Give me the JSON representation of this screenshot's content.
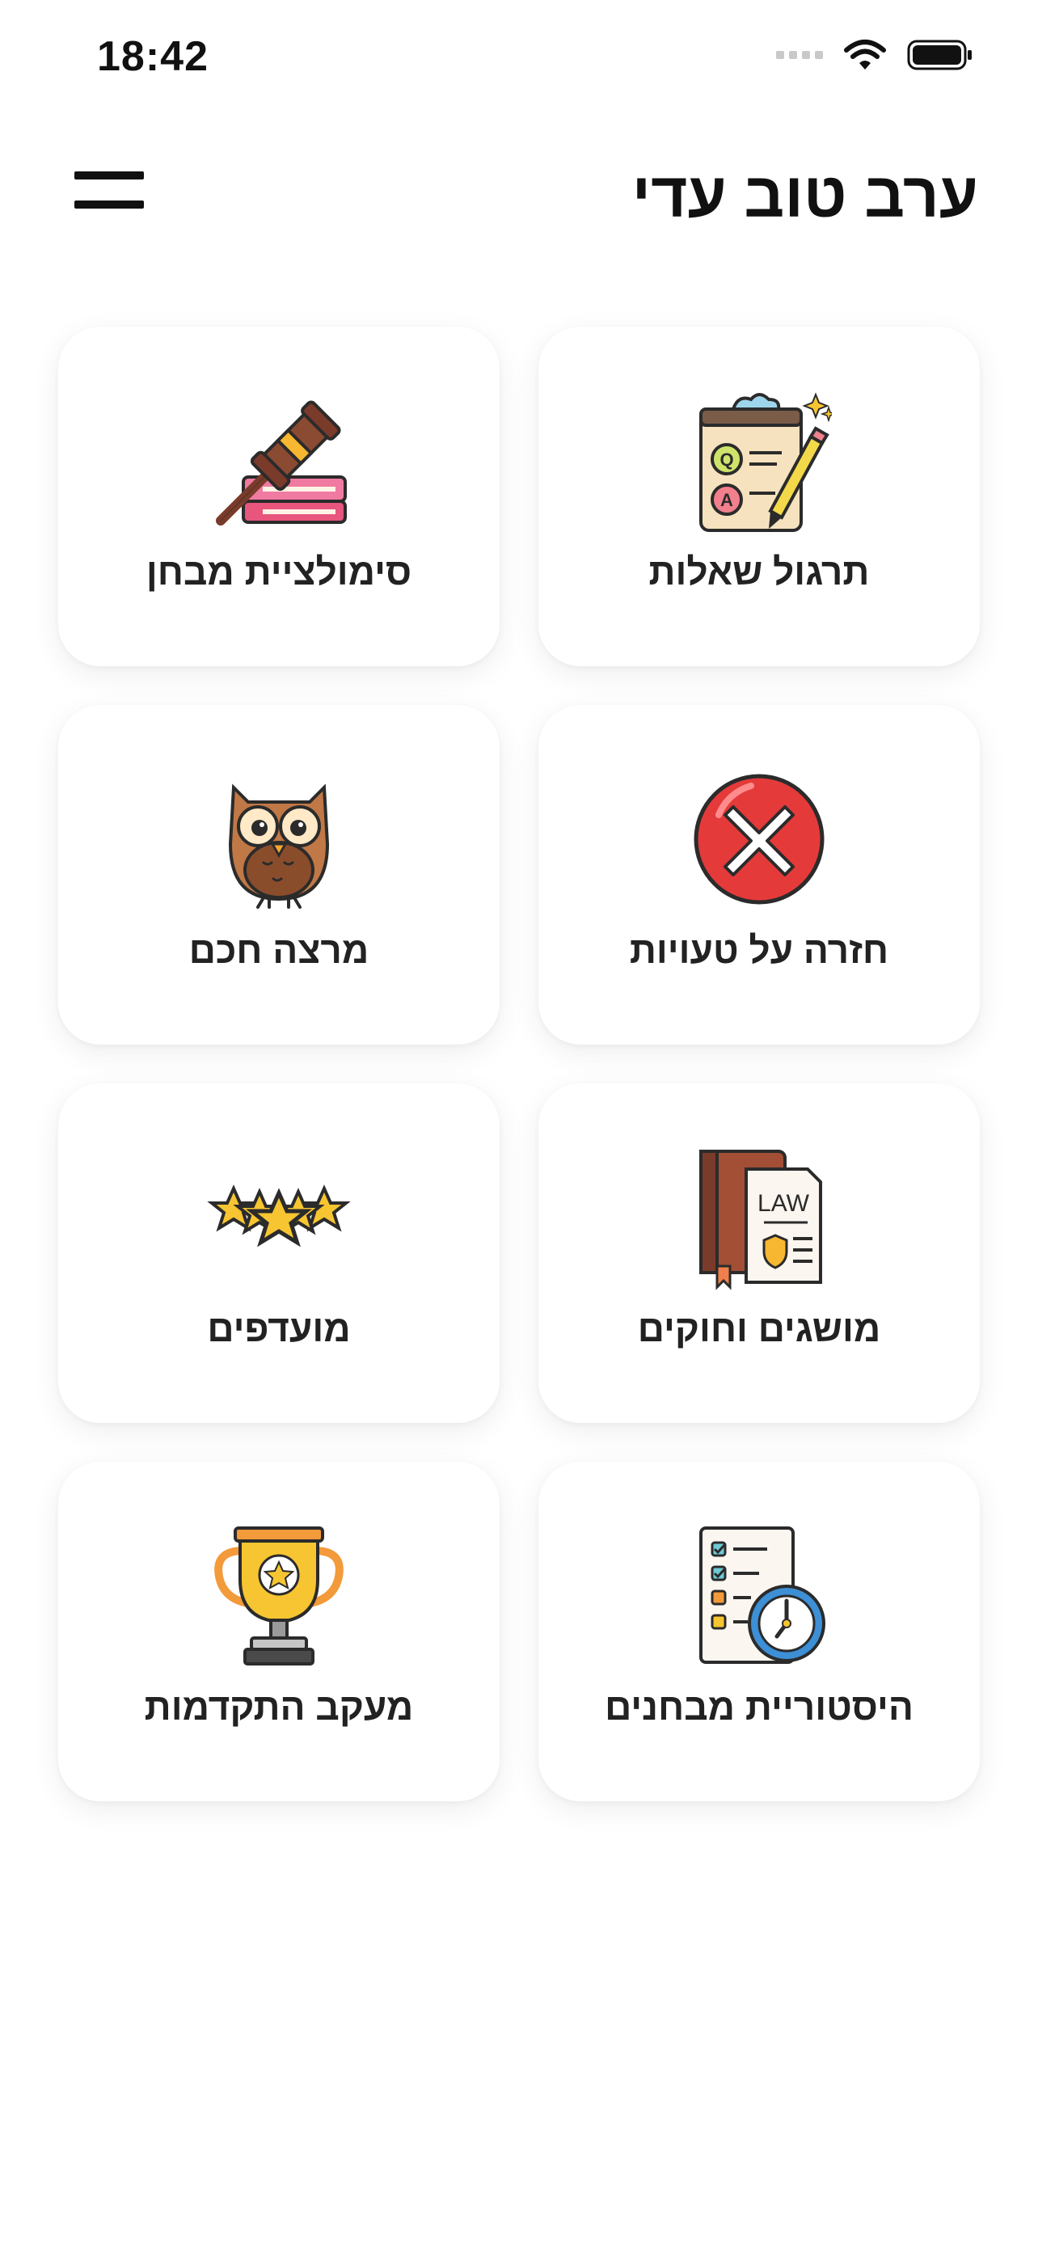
{
  "status": {
    "time": "18:42"
  },
  "header": {
    "greeting": "ערב טוב עדי"
  },
  "cards": [
    {
      "label": "תרגול שאלות",
      "icon": "quiz-clipboard-icon",
      "letters": [
        "Q",
        "A"
      ]
    },
    {
      "label": "סימולציית מבחן",
      "icon": "gavel-icon"
    },
    {
      "label": "חזרה על טעויות",
      "icon": "error-x-icon"
    },
    {
      "label": "מרצה חכם",
      "icon": "owl-icon"
    },
    {
      "label": "מושגים וחוקים",
      "icon": "law-document-icon",
      "badge": "LAW"
    },
    {
      "label": "מועדפים",
      "icon": "stars-icon"
    },
    {
      "label": "היסטוריית מבחנים",
      "icon": "checklist-clock-icon"
    },
    {
      "label": "מעקב התקדמות",
      "icon": "trophy-icon"
    }
  ],
  "colors": {
    "background": "#ffffff",
    "card": "#ffffff",
    "text": "#222222",
    "error": "#e53a3a",
    "star": "#f7c531"
  }
}
